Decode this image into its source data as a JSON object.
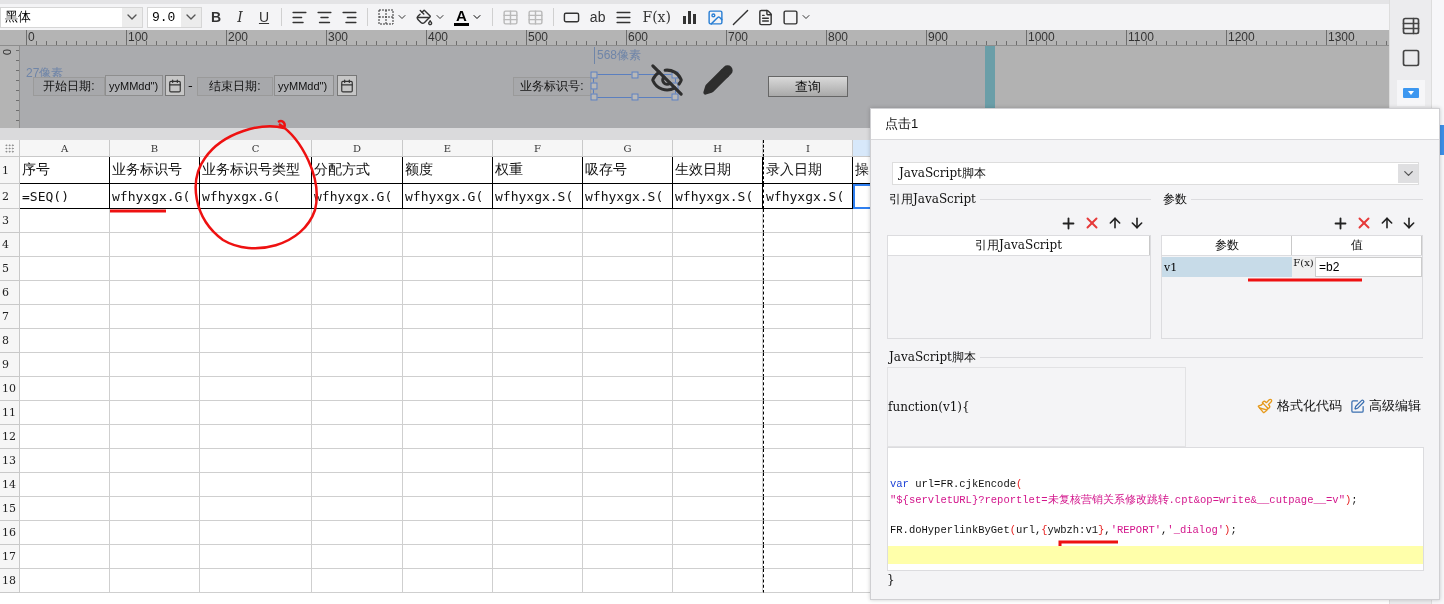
{
  "toolbar": {
    "font_name": "黑体",
    "font_size": "9.0",
    "bold": "B",
    "italic": "I",
    "underline": "U",
    "font_color": "A",
    "text_widget": "ab",
    "formula": "F(x)",
    "merge_buttons_disabled": true
  },
  "ruler": {
    "horizontal": [
      "0",
      "100",
      "200",
      "300",
      "400",
      "500",
      "600",
      "700",
      "800",
      "900",
      "1000",
      "1100",
      "1200",
      "1300"
    ],
    "vertical": [
      "0"
    ]
  },
  "parameter_pane": {
    "height_hint": "27像素",
    "start_label": "开始日期:",
    "start_field": "yyMMdd\")",
    "separator": "-",
    "end_label": "结束日期:",
    "end_field": "yyMMdd\")",
    "width_hint": "568像素",
    "id_label": "业务标识号:",
    "id_field_selected": true,
    "query_button": "查询"
  },
  "sheet": {
    "columns": [
      {
        "label": "A",
        "selected": false,
        "page_break": false
      },
      {
        "label": "B",
        "selected": false,
        "page_break": false
      },
      {
        "label": "C",
        "selected": false,
        "page_break": false
      },
      {
        "label": "D",
        "selected": false,
        "page_break": false
      },
      {
        "label": "E",
        "selected": false,
        "page_break": false
      },
      {
        "label": "F",
        "selected": false,
        "page_break": false
      },
      {
        "label": "G",
        "selected": false,
        "page_break": false
      },
      {
        "label": "H",
        "selected": false,
        "page_break": false
      },
      {
        "label": "I",
        "selected": false,
        "page_break": true
      },
      {
        "selected": true,
        "page_break": false
      }
    ],
    "rows": [
      {
        "label": "1",
        "cells": [
          {
            "text": "序号",
            "selected": false
          },
          {
            "text": "业务标识号",
            "selected": false
          },
          {
            "text": "业务标识号类型",
            "selected": false
          },
          {
            "text": "分配方式",
            "selected": false
          },
          {
            "text": "额度",
            "selected": false
          },
          {
            "text": "权重",
            "selected": false
          },
          {
            "text": "吸存号",
            "selected": false
          },
          {
            "text": "生效日期",
            "selected": false
          },
          {
            "text": "录入日期",
            "selected": false
          },
          {
            "text": "操",
            "selected": false
          }
        ]
      },
      {
        "label": "2",
        "cells": [
          {
            "text": "=SEQ()",
            "selected": false
          },
          {
            "text": "wfhyxgx.G(",
            "selected": false
          },
          {
            "text": "wfhyxgx.G(",
            "selected": false
          },
          {
            "text": "wfhyxgx.G(",
            "selected": false
          },
          {
            "text": "wfhyxgx.G(",
            "selected": false
          },
          {
            "text": "wfhyxgx.S(",
            "selected": false
          },
          {
            "text": "wfhyxgx.S(",
            "selected": false
          },
          {
            "text": "wfhyxgx.S(",
            "selected": false
          },
          {
            "text": "wfhyxgx.S(",
            "selected": false
          },
          {
            "selected": true
          }
        ]
      },
      {
        "label": "3"
      },
      {
        "label": "4"
      },
      {
        "label": "5"
      },
      {
        "label": "6"
      },
      {
        "label": "7"
      },
      {
        "label": "8"
      },
      {
        "label": "9"
      },
      {
        "label": "10"
      },
      {
        "label": "11"
      },
      {
        "label": "12"
      },
      {
        "label": "13"
      },
      {
        "label": "14"
      },
      {
        "label": "15"
      },
      {
        "label": "16"
      },
      {
        "label": "17"
      },
      {
        "label": "18"
      }
    ]
  },
  "dialog": {
    "title": "点击1",
    "type_select": "JavaScript脚本",
    "ref_group": {
      "title": "引用JavaScript",
      "column": "引用JavaScript"
    },
    "params_group": {
      "title": "参数",
      "columns": [
        "参数",
        "值"
      ],
      "rows": [
        {
          "name": "v1",
          "formula": "F(x)",
          "value": "=b2",
          "selected": true
        }
      ]
    },
    "script_group": {
      "title": "JavaScript脚本",
      "signature": "function(v1){",
      "format_button": "格式化代码",
      "advanced_button": "高级编辑",
      "closing": "}",
      "code_lines": [
        {
          "highlighted": false
        },
        {
          "highlighted": false
        },
        {
          "highlighted": false,
          "tokens": [
            {
              "text": "var",
              "kind": "keyword"
            },
            {
              "text": " url=FR.cjkEncode",
              "kind": "plain"
            },
            {
              "text": "(",
              "kind": "punct"
            }
          ]
        },
        {
          "highlighted": false,
          "tokens": [
            {
              "text": "\"${servletURL}?reportlet=未复核营销关系修改跳转.cpt&op=write&__cutpage__=v\"",
              "kind": "string"
            },
            {
              "text": ")",
              "kind": "punct"
            },
            {
              "text": ";",
              "kind": "plain"
            }
          ]
        },
        {
          "highlighted": false
        },
        {
          "highlighted": false,
          "tokens": [
            {
              "text": "FR.doHyperlinkByGet",
              "kind": "plain"
            },
            {
              "text": "(",
              "kind": "punct"
            },
            {
              "text": "url,",
              "kind": "plain"
            },
            {
              "text": "{",
              "kind": "punct"
            },
            {
              "text": "ywbzh:v1",
              "kind": "plain"
            },
            {
              "text": "}",
              "kind": "punct"
            },
            {
              "text": ",",
              "kind": "plain"
            },
            {
              "text": "'REPORT'",
              "kind": "string"
            },
            {
              "text": ",",
              "kind": "plain"
            },
            {
              "text": "'_dialog'",
              "kind": "string"
            },
            {
              "text": ")",
              "kind": "punct"
            },
            {
              "text": ";",
              "kind": "plain"
            }
          ]
        },
        {
          "highlighted": true
        }
      ]
    }
  }
}
